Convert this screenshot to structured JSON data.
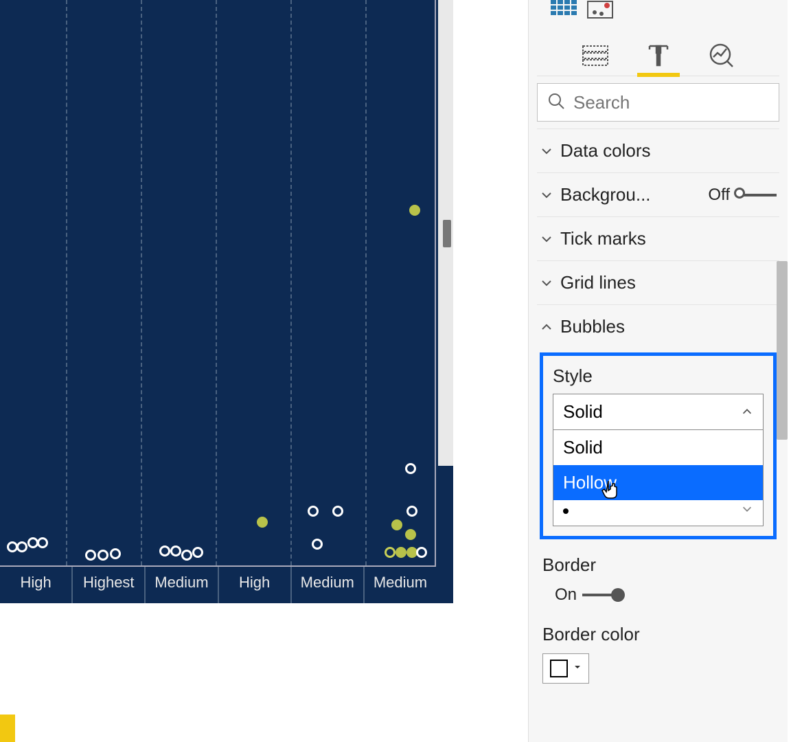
{
  "chart_data": {
    "type": "scatter",
    "categories": [
      "High",
      "Highest",
      "Medium",
      "High",
      "Medium",
      "Medium"
    ],
    "note": "y values approximate; no y-axis ticks visible",
    "series": [
      {
        "name": "bubbles",
        "points": [
          {
            "cat": 0,
            "y": 0.02
          },
          {
            "cat": 0,
            "y": 0.02
          },
          {
            "cat": 0,
            "y": 0.03
          },
          {
            "cat": 0,
            "y": 0.035
          },
          {
            "cat": 1,
            "y": 0.015
          },
          {
            "cat": 1,
            "y": 0.015
          },
          {
            "cat": 1,
            "y": 0.02
          },
          {
            "cat": 2,
            "y": 0.02
          },
          {
            "cat": 2,
            "y": 0.02
          },
          {
            "cat": 2,
            "y": 0.02
          },
          {
            "cat": 2,
            "y": 0.02
          },
          {
            "cat": 3,
            "y": 0.08,
            "fill": "green"
          },
          {
            "cat": 4,
            "y": 0.1
          },
          {
            "cat": 4,
            "y": 0.1
          },
          {
            "cat": 4,
            "y": 0.04
          },
          {
            "cat": 5,
            "y": 0.63,
            "fill": "green"
          },
          {
            "cat": 5,
            "y": 0.18
          },
          {
            "cat": 5,
            "y": 0.1
          },
          {
            "cat": 5,
            "y": 0.07,
            "fill": "green"
          },
          {
            "cat": 5,
            "y": 0.05,
            "fill": "green"
          },
          {
            "cat": 5,
            "y": 0.02
          },
          {
            "cat": 5,
            "y": 0.02
          },
          {
            "cat": 5,
            "y": 0.02,
            "fill": "green"
          },
          {
            "cat": 5,
            "y": 0.02
          }
        ]
      }
    ]
  },
  "panel": {
    "search_placeholder": "Search",
    "sections": {
      "data_colors": "Data colors",
      "background": "Backgrou...",
      "background_toggle": "Off",
      "tick_marks": "Tick marks",
      "grid_lines": "Grid lines",
      "bubbles": "Bubbles"
    },
    "bubbles": {
      "style_label": "Style",
      "selected": "Solid",
      "options": [
        "Solid",
        "Hollow"
      ],
      "border_label": "Border",
      "border_toggle": "On",
      "border_color_label": "Border color"
    }
  }
}
